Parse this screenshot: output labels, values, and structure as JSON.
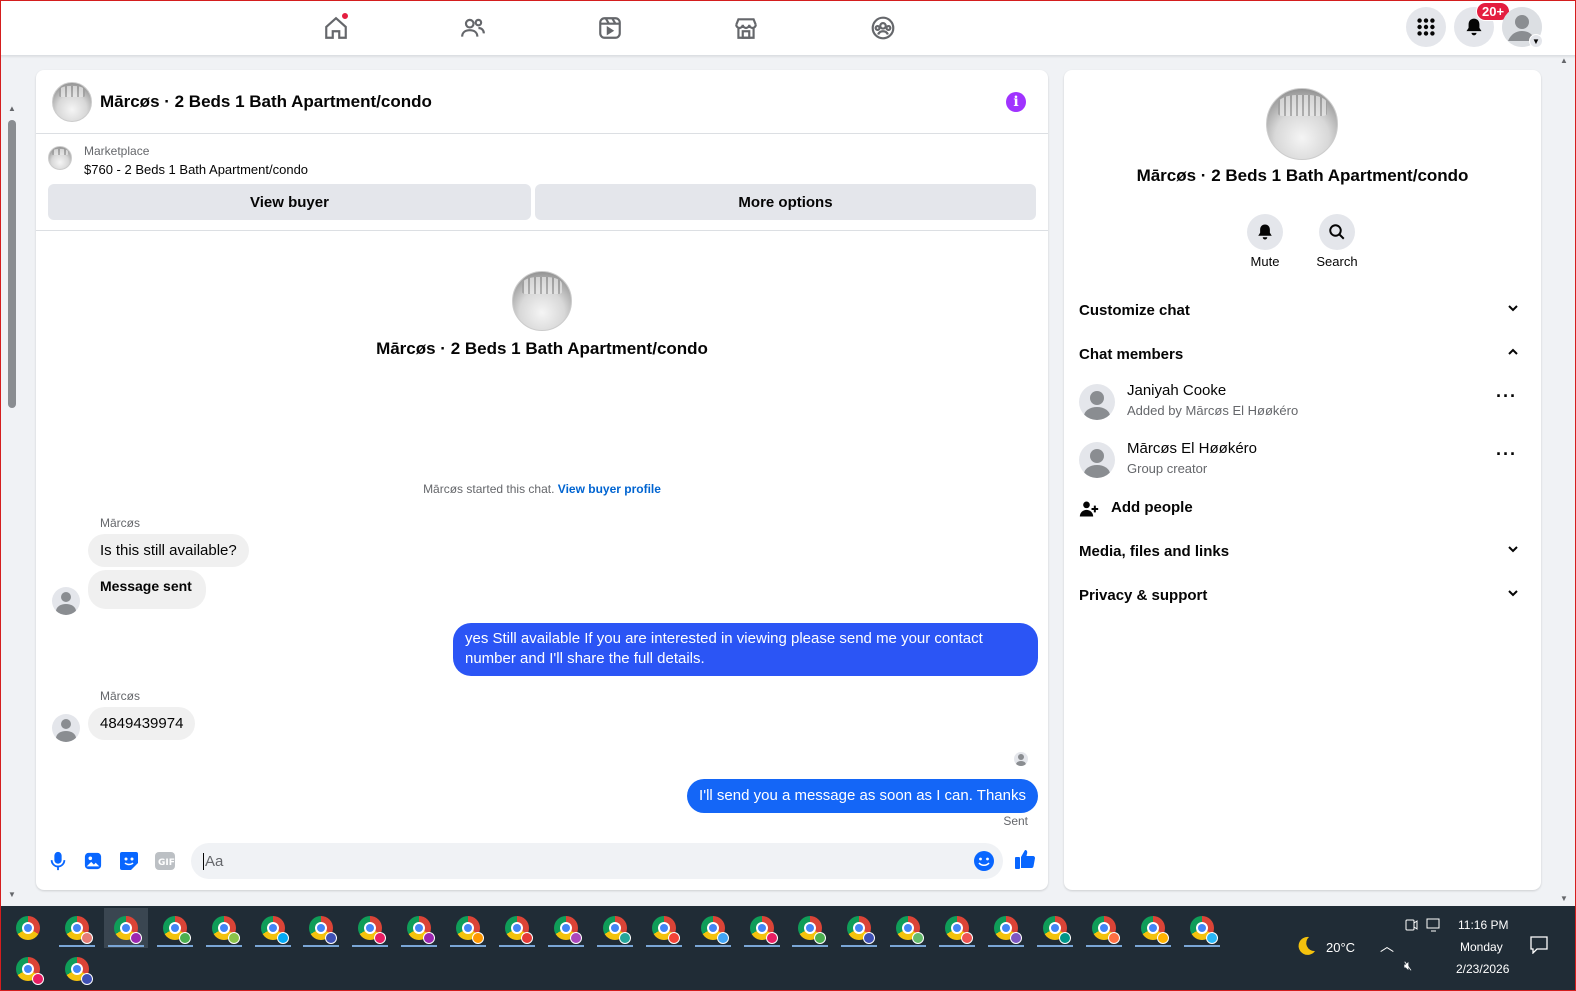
{
  "topnav": {
    "icons": [
      "home-icon",
      "friends-icon",
      "video-icon",
      "marketplace-icon",
      "groups-icon"
    ],
    "notification_badge": "20+",
    "menu_icon": "grid-menu-icon",
    "bell_icon": "bell-icon"
  },
  "chat": {
    "title": "Mārcøs · 2 Beds 1 Bath Apartment/condo",
    "marketplace_label": "Marketplace",
    "listing": "$760 - 2 Beds 1 Bath Apartment/condo",
    "view_buyer": "View buyer",
    "more_options": "More options",
    "center_name": "Mārcøs · 2 Beds 1 Bath Apartment/condo",
    "started_text": "Mārcøs started this chat.",
    "view_buyer_profile": "View buyer profile",
    "messages": [
      {
        "sender": "Mārcøs",
        "text": "Is this still available?"
      },
      {
        "text": "Message sent"
      },
      {
        "text": "yes Still available If you are interested in viewing please send me your contact number and I'll share the full details."
      },
      {
        "sender": "Mārcøs",
        "text": "4849439974"
      },
      {
        "text": "I'll send you a message as soon as I can. Thanks"
      }
    ],
    "sent_status": "Sent",
    "input_placeholder": "Aa"
  },
  "side": {
    "name": "Mārcøs · 2 Beds 1 Bath Apartment/condo",
    "mute": "Mute",
    "search": "Search",
    "customize_chat": "Customize chat",
    "chat_members": "Chat members",
    "members": [
      {
        "name": "Janiyah Cooke",
        "sub": "Added by Mārcøs El Høøkéro"
      },
      {
        "name": "Mārcøs El Høøkéro",
        "sub": "Group creator"
      }
    ],
    "add_people": "Add people",
    "media_files_links": "Media, files and links",
    "privacy_support": "Privacy & support"
  },
  "taskbar": {
    "weather": "20°C",
    "time": "11:16 PM",
    "day": "Monday",
    "date": "2/23/2026"
  },
  "colors": {
    "accent": "#0866ff",
    "bubble_out": "#2b55f5",
    "info": "#a033ff",
    "badge": "#e41e3f"
  }
}
